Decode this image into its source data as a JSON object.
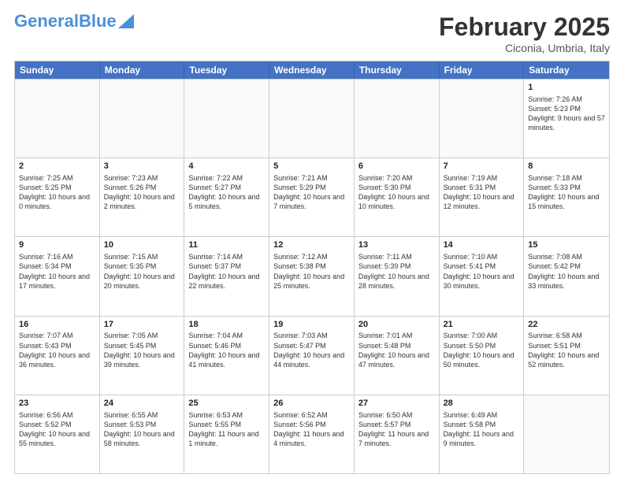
{
  "header": {
    "logo_general": "General",
    "logo_blue": "Blue",
    "month_title": "February 2025",
    "location": "Ciconia, Umbria, Italy"
  },
  "days_of_week": [
    "Sunday",
    "Monday",
    "Tuesday",
    "Wednesday",
    "Thursday",
    "Friday",
    "Saturday"
  ],
  "weeks": [
    [
      {
        "day": "",
        "empty": true
      },
      {
        "day": "",
        "empty": true
      },
      {
        "day": "",
        "empty": true
      },
      {
        "day": "",
        "empty": true
      },
      {
        "day": "",
        "empty": true
      },
      {
        "day": "",
        "empty": true
      },
      {
        "day": "1",
        "sunrise": "Sunrise: 7:26 AM",
        "sunset": "Sunset: 5:23 PM",
        "daylight": "Daylight: 9 hours and 57 minutes."
      }
    ],
    [
      {
        "day": "2",
        "sunrise": "Sunrise: 7:25 AM",
        "sunset": "Sunset: 5:25 PM",
        "daylight": "Daylight: 10 hours and 0 minutes."
      },
      {
        "day": "3",
        "sunrise": "Sunrise: 7:23 AM",
        "sunset": "Sunset: 5:26 PM",
        "daylight": "Daylight: 10 hours and 2 minutes."
      },
      {
        "day": "4",
        "sunrise": "Sunrise: 7:22 AM",
        "sunset": "Sunset: 5:27 PM",
        "daylight": "Daylight: 10 hours and 5 minutes."
      },
      {
        "day": "5",
        "sunrise": "Sunrise: 7:21 AM",
        "sunset": "Sunset: 5:29 PM",
        "daylight": "Daylight: 10 hours and 7 minutes."
      },
      {
        "day": "6",
        "sunrise": "Sunrise: 7:20 AM",
        "sunset": "Sunset: 5:30 PM",
        "daylight": "Daylight: 10 hours and 10 minutes."
      },
      {
        "day": "7",
        "sunrise": "Sunrise: 7:19 AM",
        "sunset": "Sunset: 5:31 PM",
        "daylight": "Daylight: 10 hours and 12 minutes."
      },
      {
        "day": "8",
        "sunrise": "Sunrise: 7:18 AM",
        "sunset": "Sunset: 5:33 PM",
        "daylight": "Daylight: 10 hours and 15 minutes."
      }
    ],
    [
      {
        "day": "9",
        "sunrise": "Sunrise: 7:16 AM",
        "sunset": "Sunset: 5:34 PM",
        "daylight": "Daylight: 10 hours and 17 minutes."
      },
      {
        "day": "10",
        "sunrise": "Sunrise: 7:15 AM",
        "sunset": "Sunset: 5:35 PM",
        "daylight": "Daylight: 10 hours and 20 minutes."
      },
      {
        "day": "11",
        "sunrise": "Sunrise: 7:14 AM",
        "sunset": "Sunset: 5:37 PM",
        "daylight": "Daylight: 10 hours and 22 minutes."
      },
      {
        "day": "12",
        "sunrise": "Sunrise: 7:12 AM",
        "sunset": "Sunset: 5:38 PM",
        "daylight": "Daylight: 10 hours and 25 minutes."
      },
      {
        "day": "13",
        "sunrise": "Sunrise: 7:11 AM",
        "sunset": "Sunset: 5:39 PM",
        "daylight": "Daylight: 10 hours and 28 minutes."
      },
      {
        "day": "14",
        "sunrise": "Sunrise: 7:10 AM",
        "sunset": "Sunset: 5:41 PM",
        "daylight": "Daylight: 10 hours and 30 minutes."
      },
      {
        "day": "15",
        "sunrise": "Sunrise: 7:08 AM",
        "sunset": "Sunset: 5:42 PM",
        "daylight": "Daylight: 10 hours and 33 minutes."
      }
    ],
    [
      {
        "day": "16",
        "sunrise": "Sunrise: 7:07 AM",
        "sunset": "Sunset: 5:43 PM",
        "daylight": "Daylight: 10 hours and 36 minutes."
      },
      {
        "day": "17",
        "sunrise": "Sunrise: 7:05 AM",
        "sunset": "Sunset: 5:45 PM",
        "daylight": "Daylight: 10 hours and 39 minutes."
      },
      {
        "day": "18",
        "sunrise": "Sunrise: 7:04 AM",
        "sunset": "Sunset: 5:46 PM",
        "daylight": "Daylight: 10 hours and 41 minutes."
      },
      {
        "day": "19",
        "sunrise": "Sunrise: 7:03 AM",
        "sunset": "Sunset: 5:47 PM",
        "daylight": "Daylight: 10 hours and 44 minutes."
      },
      {
        "day": "20",
        "sunrise": "Sunrise: 7:01 AM",
        "sunset": "Sunset: 5:48 PM",
        "daylight": "Daylight: 10 hours and 47 minutes."
      },
      {
        "day": "21",
        "sunrise": "Sunrise: 7:00 AM",
        "sunset": "Sunset: 5:50 PM",
        "daylight": "Daylight: 10 hours and 50 minutes."
      },
      {
        "day": "22",
        "sunrise": "Sunrise: 6:58 AM",
        "sunset": "Sunset: 5:51 PM",
        "daylight": "Daylight: 10 hours and 52 minutes."
      }
    ],
    [
      {
        "day": "23",
        "sunrise": "Sunrise: 6:56 AM",
        "sunset": "Sunset: 5:52 PM",
        "daylight": "Daylight: 10 hours and 55 minutes."
      },
      {
        "day": "24",
        "sunrise": "Sunrise: 6:55 AM",
        "sunset": "Sunset: 5:53 PM",
        "daylight": "Daylight: 10 hours and 58 minutes."
      },
      {
        "day": "25",
        "sunrise": "Sunrise: 6:53 AM",
        "sunset": "Sunset: 5:55 PM",
        "daylight": "Daylight: 11 hours and 1 minute."
      },
      {
        "day": "26",
        "sunrise": "Sunrise: 6:52 AM",
        "sunset": "Sunset: 5:56 PM",
        "daylight": "Daylight: 11 hours and 4 minutes."
      },
      {
        "day": "27",
        "sunrise": "Sunrise: 6:50 AM",
        "sunset": "Sunset: 5:57 PM",
        "daylight": "Daylight: 11 hours and 7 minutes."
      },
      {
        "day": "28",
        "sunrise": "Sunrise: 6:49 AM",
        "sunset": "Sunset: 5:58 PM",
        "daylight": "Daylight: 11 hours and 9 minutes."
      },
      {
        "day": "",
        "empty": true
      }
    ]
  ]
}
